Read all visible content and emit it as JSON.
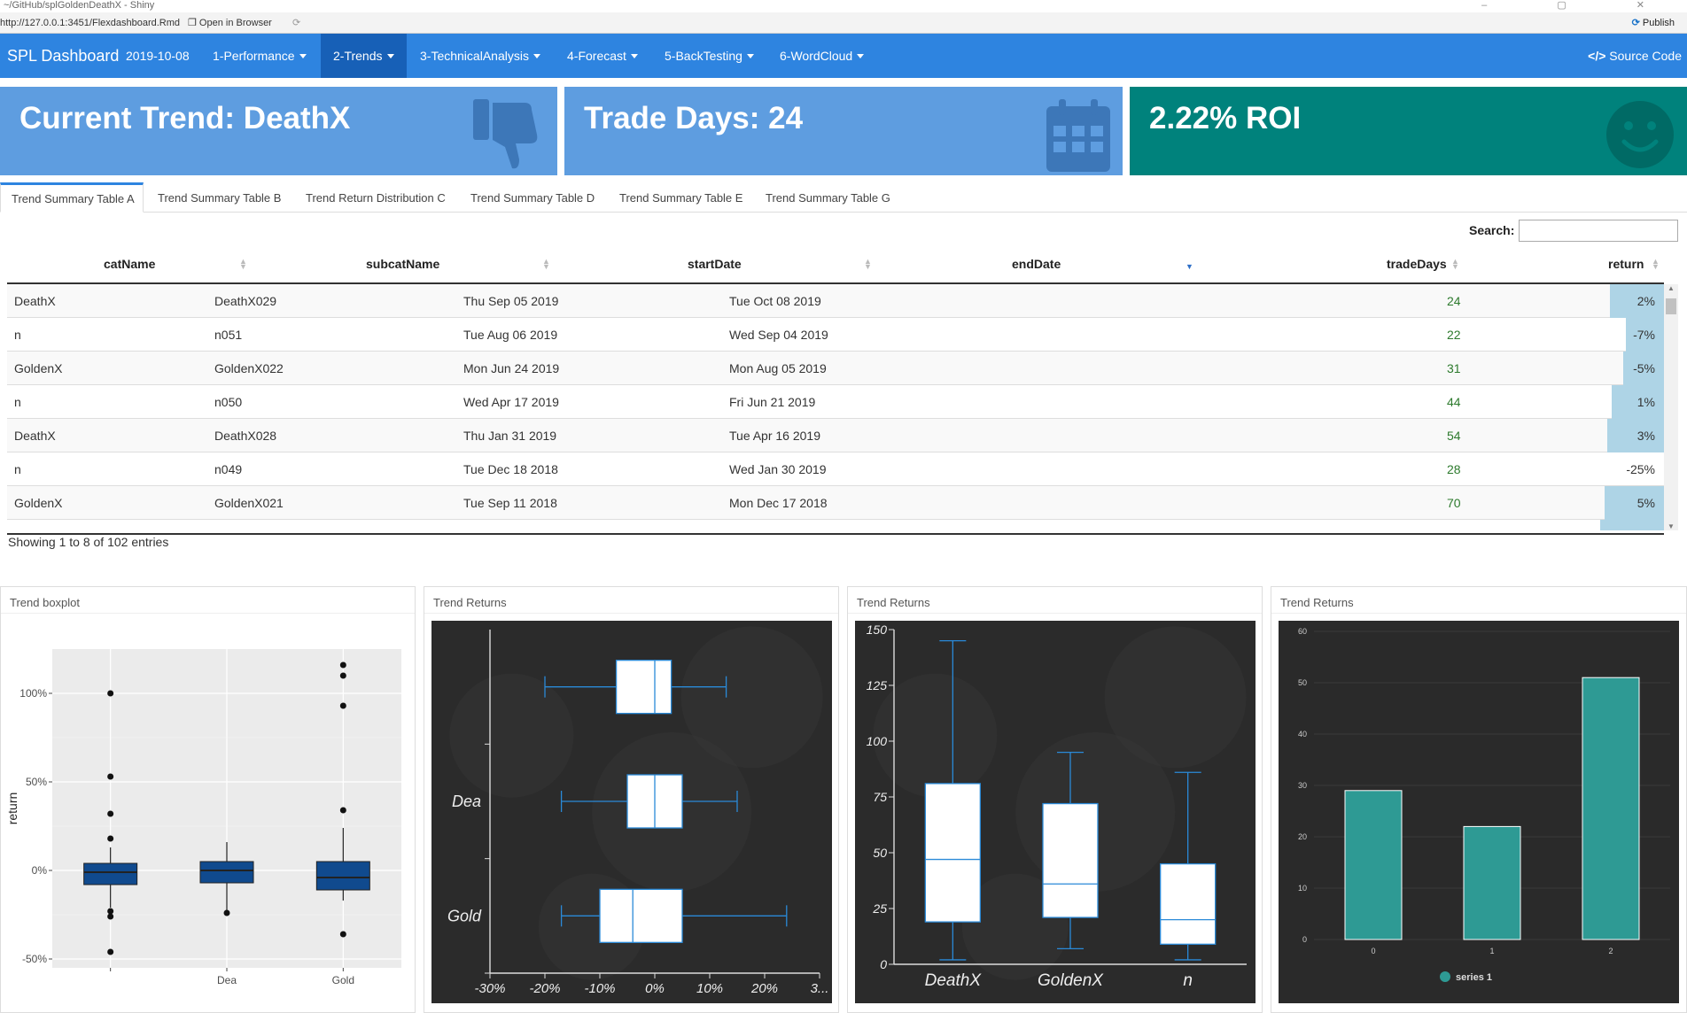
{
  "window": {
    "title": "~/GitHub/splGoldenDeathX - Shiny"
  },
  "addressbar": {
    "url": "http://127.0.0.1:3451/Flexdashboard.Rmd",
    "open_browser": "Open in Browser",
    "publish": "Publish"
  },
  "navbar": {
    "brand": "SPL Dashboard",
    "date": "2019-10-08",
    "items": [
      "1-Performance",
      "2-Trends",
      "3-TechnicalAnalysis",
      "4-Forecast",
      "5-BackTesting",
      "6-WordCloud"
    ],
    "active": "2-Trends",
    "source_code": "Source Code"
  },
  "valueboxes": [
    {
      "text": "Current Trend: DeathX",
      "icon": "thumbs-down-icon",
      "color": "#5e9de0"
    },
    {
      "text": "Trade Days: 24",
      "icon": "calendar-icon",
      "color": "#5e9de0"
    },
    {
      "text": "2.22% ROI",
      "icon": "smile-icon",
      "color": "#00827c"
    }
  ],
  "tabs": [
    "Trend Summary Table A",
    "Trend Summary Table B",
    "Trend Return Distribution C",
    "Trend Summary Table D",
    "Trend Summary Table E",
    "Trend Summary Table G"
  ],
  "table": {
    "search_label": "Search:",
    "search_value": "",
    "columns": [
      "catName",
      "subcatName",
      "startDate",
      "endDate",
      "tradeDays",
      "return"
    ],
    "sorted_by": "endDate",
    "rows": [
      {
        "catName": "DeathX",
        "subcatName": "DeathX029",
        "startDate": "Thu Sep 05 2019",
        "endDate": "Tue Oct 08 2019",
        "tradeDays": "24",
        "return": "2%",
        "ret_bar": 0.38
      },
      {
        "catName": "n",
        "subcatName": "n051",
        "startDate": "Tue Aug 06 2019",
        "endDate": "Wed Sep 04 2019",
        "tradeDays": "22",
        "return": "-7%",
        "ret_bar": 0.27
      },
      {
        "catName": "GoldenX",
        "subcatName": "GoldenX022",
        "startDate": "Mon Jun 24 2019",
        "endDate": "Mon Aug 05 2019",
        "tradeDays": "31",
        "return": "-5%",
        "ret_bar": 0.29
      },
      {
        "catName": "n",
        "subcatName": "n050",
        "startDate": "Wed Apr 17 2019",
        "endDate": "Fri Jun 21 2019",
        "tradeDays": "44",
        "return": "1%",
        "ret_bar": 0.37
      },
      {
        "catName": "DeathX",
        "subcatName": "DeathX028",
        "startDate": "Thu Jan 31 2019",
        "endDate": "Tue Apr 16 2019",
        "tradeDays": "54",
        "return": "3%",
        "ret_bar": 0.4
      },
      {
        "catName": "n",
        "subcatName": "n049",
        "startDate": "Tue Dec 18 2018",
        "endDate": "Wed Jan 30 2019",
        "tradeDays": "28",
        "return": "-25%",
        "ret_bar": 0.0
      },
      {
        "catName": "GoldenX",
        "subcatName": "GoldenX021",
        "startDate": "Tue Sep 11 2018",
        "endDate": "Mon Dec 17 2018",
        "tradeDays": "70",
        "return": "5%",
        "ret_bar": 0.42
      },
      {
        "catName": "",
        "subcatName": "",
        "startDate": "",
        "endDate": "",
        "tradeDays": "",
        "return": "",
        "ret_bar": 0.45
      }
    ],
    "info": "Showing 1 to 8 of 102 entries"
  },
  "panels": {
    "p1": {
      "title": "Trend boxplot"
    },
    "p2": {
      "title": "Trend Returns"
    },
    "p3": {
      "title": "Trend Returns"
    },
    "p4": {
      "title": "Trend Returns"
    }
  },
  "chart_data": [
    {
      "type": "boxplot",
      "ylabel": "return",
      "y_ticks": [
        "100%",
        "50%",
        "0%",
        "-50%"
      ],
      "ylim": [
        -0.55,
        1.25
      ],
      "categories": [
        "",
        "Dea",
        "Gold"
      ],
      "boxes": [
        {
          "q1": -0.08,
          "median": -0.01,
          "q3": 0.04,
          "low": -0.21,
          "high": 0.13,
          "outliers": [
            1.0,
            0.53,
            0.32,
            0.18,
            -0.23,
            -0.26,
            -0.46
          ]
        },
        {
          "q1": -0.07,
          "median": 0.0,
          "q3": 0.05,
          "low": -0.24,
          "high": 0.16,
          "outliers": [
            -0.24
          ]
        },
        {
          "q1": -0.11,
          "median": -0.04,
          "q3": 0.05,
          "low": -0.17,
          "high": 0.24,
          "outliers": [
            1.16,
            1.1,
            0.93,
            0.34,
            -0.36
          ]
        }
      ],
      "grid": true
    },
    {
      "type": "boxplot",
      "orientation": "horizontal",
      "x_ticks": [
        "-30%",
        "-20%",
        "-10%",
        "0%",
        "10%",
        "20%",
        "3..."
      ],
      "xlim": [
        -0.3,
        0.3
      ],
      "categories": [
        "",
        "Dea",
        "Gold"
      ],
      "boxes": [
        {
          "q1": -0.07,
          "median": 0.0,
          "q3": 0.03,
          "low": -0.2,
          "high": 0.13
        },
        {
          "q1": -0.05,
          "median": 0.0,
          "q3": 0.05,
          "low": -0.17,
          "high": 0.15
        },
        {
          "q1": -0.1,
          "median": -0.04,
          "q3": 0.05,
          "low": -0.17,
          "high": 0.24
        }
      ]
    },
    {
      "type": "boxplot",
      "y_ticks": [
        "150",
        "125",
        "100",
        "75",
        "50",
        "25",
        "0"
      ],
      "ylim": [
        0,
        150
      ],
      "categories": [
        "DeathX",
        "GoldenX",
        "n"
      ],
      "boxes": [
        {
          "q1": 19,
          "median": 47,
          "q3": 81,
          "low": 2,
          "high": 145
        },
        {
          "q1": 21,
          "median": 36,
          "q3": 72,
          "low": 7,
          "high": 95
        },
        {
          "q1": 9,
          "median": 20,
          "q3": 45,
          "low": 2,
          "high": 86
        }
      ]
    },
    {
      "type": "bar",
      "categories": [
        "0",
        "1",
        "2"
      ],
      "series": [
        {
          "name": "series 1",
          "values": [
            29,
            22,
            51
          ]
        }
      ],
      "y_ticks": [
        "60",
        "50",
        "40",
        "30",
        "20",
        "10",
        "0"
      ],
      "ylim": [
        0,
        60
      ],
      "legend": "bottom",
      "bar_color": "#2e9a94"
    }
  ]
}
